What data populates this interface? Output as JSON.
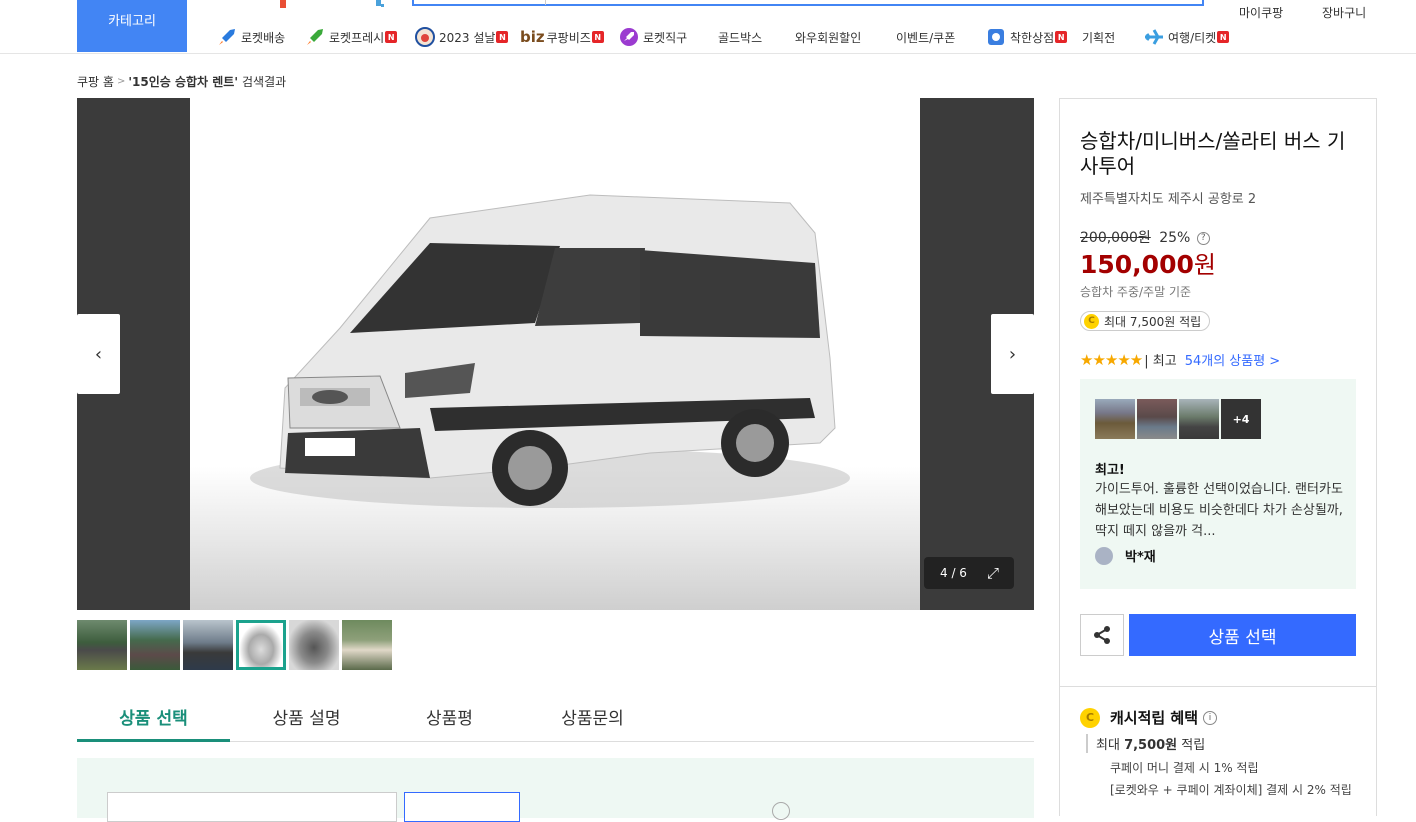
{
  "header": {
    "category_button": "카테고리",
    "nav": [
      {
        "label": "로켓배송",
        "icon": "rocket-icon",
        "badge": ""
      },
      {
        "label": "로켓프레시",
        "icon": "rocket-fresh-icon",
        "badge": "N"
      },
      {
        "label": "2023 설날",
        "icon": "new-year-icon",
        "badge": "N"
      },
      {
        "label": "쿠팡비즈",
        "icon": "biz-logo",
        "badge": "N"
      },
      {
        "label": "로켓직구",
        "icon": "rocket-global-icon",
        "badge": ""
      },
      {
        "label": "골드박스",
        "icon": "",
        "badge": ""
      },
      {
        "label": "와우회원할인",
        "icon": "",
        "badge": ""
      },
      {
        "label": "이벤트/쿠폰",
        "icon": "",
        "badge": ""
      },
      {
        "label": "착한상점",
        "icon": "good-store-icon",
        "badge": "N"
      },
      {
        "label": "기획전",
        "icon": "",
        "badge": ""
      },
      {
        "label": "여행/티켓",
        "icon": "airplane-icon",
        "badge": "N"
      }
    ],
    "biz_logo_text": "biz",
    "my_coupang": "마이쿠팡",
    "cart": "장바구니"
  },
  "breadcrumb": {
    "home": "쿠팡 홈",
    "query": "'15인승 승합차 렌트'",
    "suffix": "검색결과"
  },
  "gallery": {
    "counter": "4 / 6",
    "selected_thumb": 4,
    "thumb_count": 6
  },
  "tabs": [
    "상품 선택",
    "상품 설명",
    "상품평",
    "상품문의"
  ],
  "product": {
    "title": "승합차/미니버스/쏠라티 버스 기사투어",
    "address": "제주특별자치도 제주시 공항로 2",
    "original_price": "200,000원",
    "discount": "25%",
    "price": "150,000",
    "price_unit": "원",
    "price_basis": "승합차 주중/주말 기준",
    "point": "최대 7,500원 적립",
    "rating": 5,
    "rating_word": "| 최고",
    "review_link": "54개의 상품평 >",
    "review": {
      "more_photos": "+4",
      "title": "최고!",
      "text": "가이드투어. 훌륭한 선택이었습니다. 랜터카도 해보았는데 비용도 비슷한데다 차가 손상될까, 딱지 떼지 않을까 걱...",
      "user": "박*재"
    },
    "select_button": "상품 선택"
  },
  "cash": {
    "title": "캐시적립 혜택",
    "max_label": "최대",
    "max_amount": "7,500원",
    "max_suffix": "적립",
    "line1": "쿠페이 머니 결제 시 1% 적립",
    "line2": "[로켓와우 + 쿠페이 계좌이체] 결제 시 2% 적립"
  },
  "colors": {
    "accent_blue": "#346aff",
    "category_blue": "#4285f4",
    "price_red": "#a30000",
    "tab_green": "#1a8f7a",
    "badge_red": "#e52528"
  }
}
